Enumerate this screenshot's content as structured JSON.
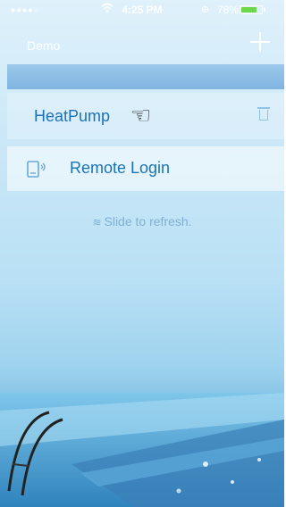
{
  "status_bar": {
    "signal": "●●●●○",
    "time": "4:25 PM",
    "battery": "78%",
    "battery_level": 0.78
  },
  "nav": {
    "title": "Demo",
    "add_icon": "plus-icon"
  },
  "devices": [
    {
      "label": "HeatPump",
      "icon": "pointing-hand-icon",
      "delete_icon": "trash-icon"
    }
  ],
  "remote_login": {
    "label": "Remote Login",
    "icon": "remote-device-icon"
  },
  "refresh_hint": "Slide to refresh.",
  "colors": {
    "accent": "#1b73b5",
    "battery": "#6ad84a"
  }
}
